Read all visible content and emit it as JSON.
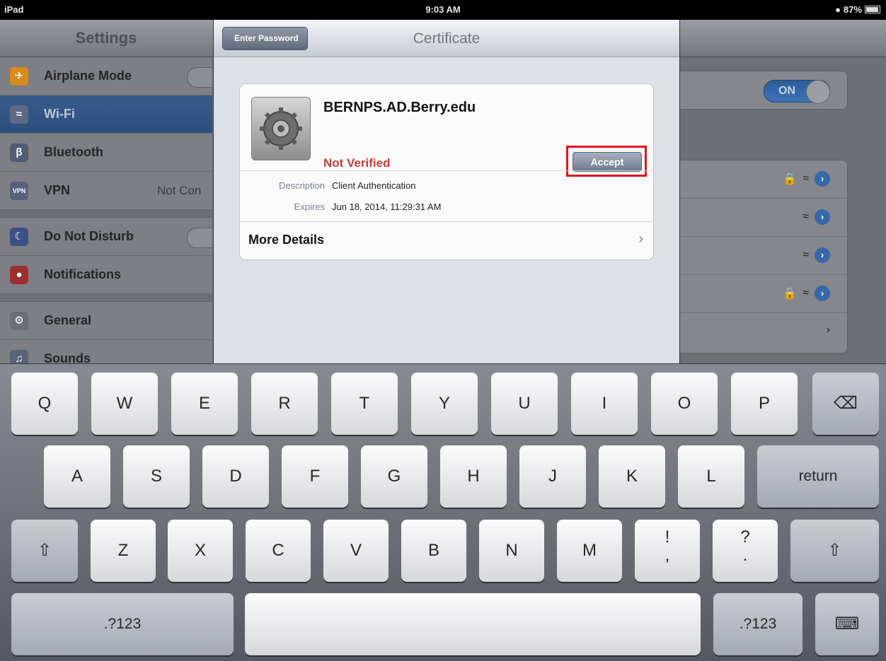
{
  "status_bar": {
    "carrier": "iPad",
    "time": "9:03 AM",
    "battery": "87%"
  },
  "settings": {
    "title": "Settings",
    "items": [
      {
        "label": "Airplane Mode",
        "icon": "airplane-icon",
        "value": ""
      },
      {
        "label": "Wi-Fi",
        "icon": "wifi-icon",
        "value": ""
      },
      {
        "label": "Bluetooth",
        "icon": "bluetooth-icon",
        "value": ""
      },
      {
        "label": "VPN",
        "icon": "vpn-icon",
        "value": "Not Con"
      },
      {
        "label": "Do Not Disturb",
        "icon": "moon-icon",
        "value": ""
      },
      {
        "label": "Notifications",
        "icon": "notifications-icon",
        "value": ""
      },
      {
        "label": "General",
        "icon": "gear-icon",
        "value": ""
      },
      {
        "label": "Sounds",
        "icon": "speaker-icon",
        "value": ""
      }
    ],
    "wifi_toggle": "ON"
  },
  "popover": {
    "back_label": "Enter Password",
    "title": "Certificate",
    "cert": {
      "name": "BERNPS.AD.Berry.edu",
      "status": "Not Verified",
      "accept_label": "Accept",
      "description_key": "Description",
      "description_value": "Client Authentication",
      "expires_key": "Expires",
      "expires_value": "Jun 18, 2014, 11:29:31 AM",
      "more_details": "More Details"
    }
  },
  "keyboard": {
    "row1": [
      "Q",
      "W",
      "E",
      "R",
      "T",
      "Y",
      "U",
      "I",
      "O",
      "P"
    ],
    "row2": [
      "A",
      "S",
      "D",
      "F",
      "G",
      "H",
      "J",
      "K",
      "L"
    ],
    "row2_return": "return",
    "row3": [
      "Z",
      "X",
      "C",
      "V",
      "B",
      "N",
      "M"
    ],
    "punct1_top": "!",
    "punct1_bottom": ",",
    "punct2_top": "?",
    "punct2_bottom": ".",
    "numbers_label": ".?123"
  },
  "colors": {
    "accent": "#2d4e7f",
    "warning_red": "#c93b3b",
    "highlight_box": "#e1141f"
  }
}
